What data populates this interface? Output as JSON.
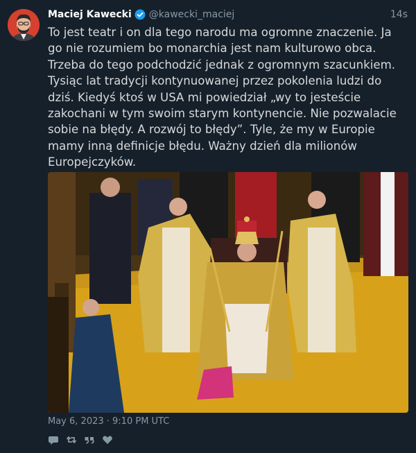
{
  "tweet": {
    "author_name": "Maciej Kawecki",
    "handle": "@kawecki_maciej",
    "relative_time": "14s",
    "text": "To jest teatr i on dla tego narodu ma ogromne znaczenie. Ja go nie rozumiem bo monarchia jest nam kulturowo obca. Trzeba do tego podchodzić jednak z ogromnym szacunkiem. Tysiąc lat tradycji kontynuowanej przez pokolenia ludzi do dziś. Kiedyś ktoś w USA mi powiedział „wy to jesteście zakochani w tym swoim starym kontynencie. Nie pozwalacie sobie na błędy. A rozwój to błędy”. Tyle, że my w Europie mamy inną definicje błędu. Ważny dzień dla milionów Europejczyków.",
    "date": "May 6, 2023 · 9:10 PM UTC",
    "verified": true
  },
  "icons": {
    "verified": "verified-badge-icon",
    "reply": "reply-icon",
    "retweet": "retweet-icon",
    "quote": "quote-icon",
    "like": "heart-icon"
  },
  "colors": {
    "background": "#15202b",
    "verified": "#1d9bf0",
    "muted": "#8899a6",
    "avatar_bg": "#d6402f"
  }
}
